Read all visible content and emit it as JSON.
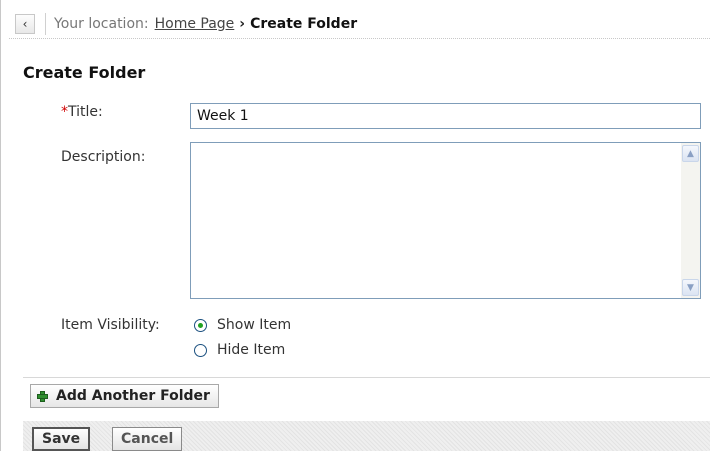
{
  "breadcrumb": {
    "back_icon": "chevron-left-icon",
    "location_label": "Your location:",
    "home_link": "Home Page",
    "separator": "›",
    "current": "Create Folder"
  },
  "page": {
    "title": "Create Folder"
  },
  "form": {
    "required_marker": "*",
    "title_label": "Title:",
    "title_value": "Week 1",
    "description_label": "Description:",
    "description_value": "",
    "visibility_label": "Item Visibility:",
    "visibility_options": [
      {
        "label": "Show Item",
        "selected": true
      },
      {
        "label": "Hide Item",
        "selected": false
      }
    ]
  },
  "actions": {
    "add_another_label": "Add Another Folder",
    "add_icon": "plus-icon",
    "save_label": "Save",
    "cancel_label": "Cancel"
  },
  "colors": {
    "required": "#d00000",
    "radio_selected": "#21a121",
    "input_border": "#7f9db9"
  }
}
